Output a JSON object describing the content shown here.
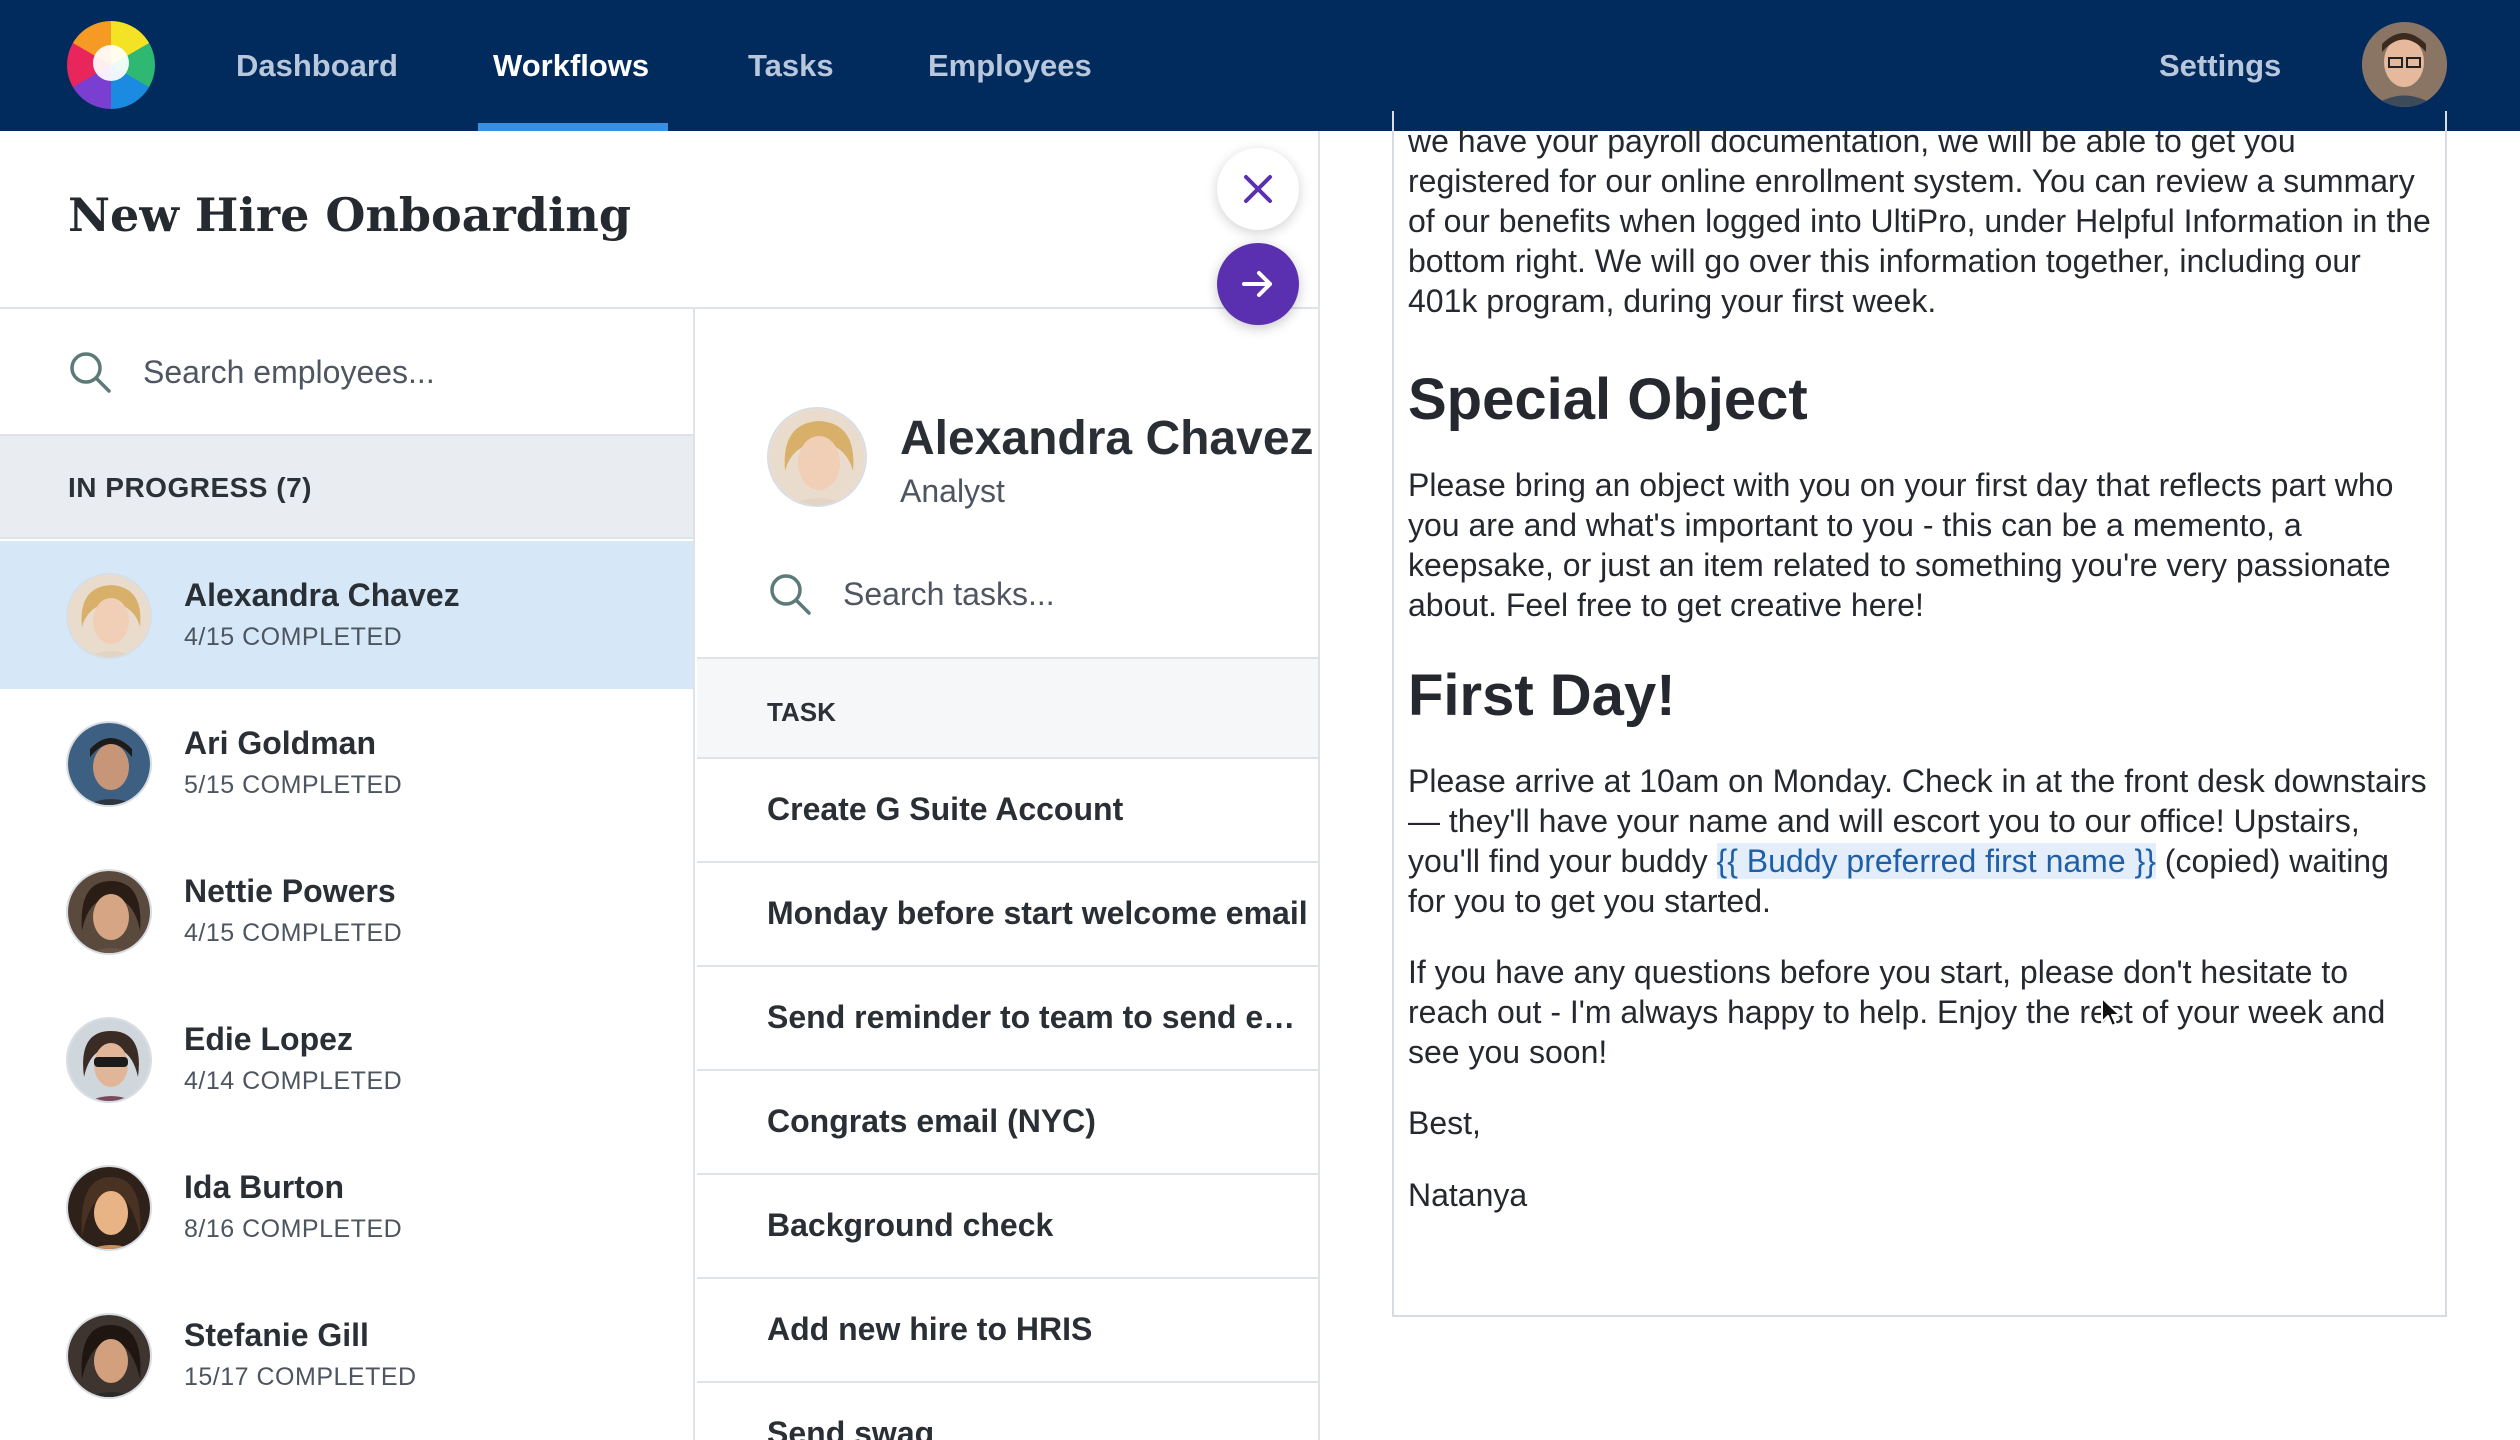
{
  "nav": {
    "items": [
      {
        "label": "Dashboard",
        "active": false
      },
      {
        "label": "Workflows",
        "active": true
      },
      {
        "label": "Tasks",
        "active": false
      },
      {
        "label": "Employees",
        "active": false
      }
    ],
    "settings_label": "Settings"
  },
  "page": {
    "title": "New Hire Onboarding"
  },
  "employees": {
    "search_placeholder": "Search employees...",
    "group_label": "IN PROGRESS (7)",
    "items": [
      {
        "name": "Alexandra Chavez",
        "progress": "4/15 COMPLETED",
        "selected": true
      },
      {
        "name": "Ari Goldman",
        "progress": "5/15 COMPLETED",
        "selected": false
      },
      {
        "name": "Nettie Powers",
        "progress": "4/15 COMPLETED",
        "selected": false
      },
      {
        "name": "Edie Lopez",
        "progress": "4/14 COMPLETED",
        "selected": false
      },
      {
        "name": "Ida Burton",
        "progress": "8/16 COMPLETED",
        "selected": false
      },
      {
        "name": "Stefanie Gill",
        "progress": "15/17 COMPLETED",
        "selected": false
      }
    ]
  },
  "profile": {
    "name": "Alexandra Chavez",
    "role": "Analyst"
  },
  "tasks": {
    "search_placeholder": "Search tasks...",
    "column_header": "TASK",
    "items": [
      "Create G Suite Account",
      "Monday before start welcome email",
      "Send reminder to team to send enc...",
      "Congrats email (NYC)",
      "Background check",
      "Add new hire to HRIS",
      "Send swag"
    ]
  },
  "document": {
    "intro_paragraph": "we have your payroll documentation, we will be able to get you registered for our online enrollment system. You can review a summary of our benefits when logged into UltiPro, under Helpful Information in the bottom right. We will go over this information together, including our 401k program, during your first week.",
    "heading_special": "Special Object",
    "special_paragraph": "Please bring an object with you on your first day that reflects part who you are and what's important to you - this can be a memento, a keepsake, or just an item related to something you're very passionate about. Feel free to get creative here!",
    "heading_first_day": "First Day!",
    "first_day_before": "Please arrive at 10am on Monday. Check in at the front desk downstairs — they'll have your name and will escort you to our office! Upstairs, you'll find your buddy ",
    "first_day_variable": "{{ Buddy preferred first name }}",
    "first_day_after": " (copied) waiting for you to get you started.",
    "questions_paragraph": "If you have any questions before you start, please don't hesitate to reach out - I'm always happy to help. Enjoy the rest of your week and see you soon!",
    "signoff": "Best,",
    "signature": "Natanya"
  },
  "icons": {
    "search": "search-icon",
    "close": "close-icon",
    "next": "arrow-right-icon"
  },
  "colors": {
    "nav_bg": "#012b5d",
    "nav_active_underline": "#3b8fe0",
    "selected_row": "#d6e8f7",
    "primary_button": "#5a2fb0",
    "variable_highlight": "#e3eefa"
  }
}
